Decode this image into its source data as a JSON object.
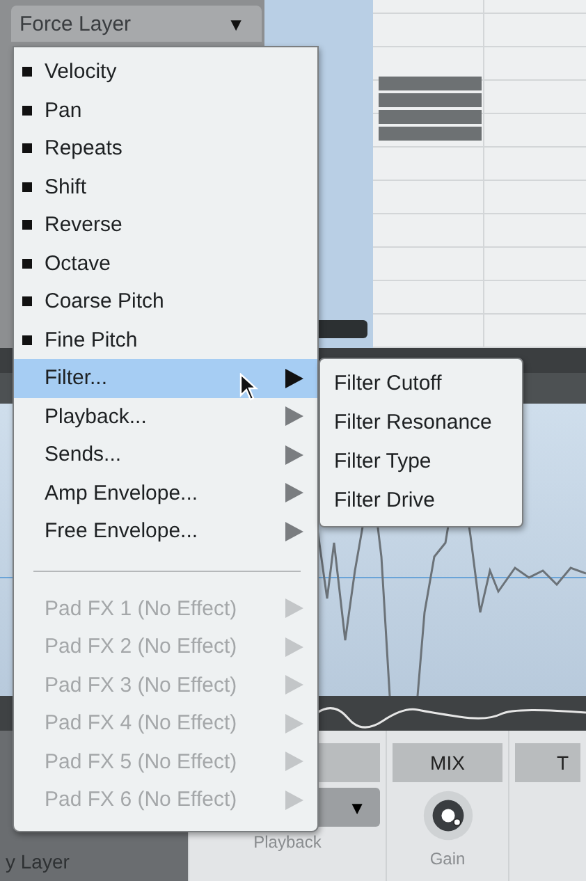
{
  "dropdown": {
    "label": "Force Layer",
    "arrow": "▼"
  },
  "menu": {
    "items": [
      {
        "kind": "bullet",
        "label": "Velocity",
        "selected": false
      },
      {
        "kind": "bullet",
        "label": "Pan",
        "selected": false
      },
      {
        "kind": "bullet",
        "label": "Repeats",
        "selected": false
      },
      {
        "kind": "bullet",
        "label": "Shift",
        "selected": false
      },
      {
        "kind": "bullet",
        "label": "Reverse",
        "selected": false
      },
      {
        "kind": "bullet",
        "label": "Octave",
        "selected": false
      },
      {
        "kind": "bullet",
        "label": "Coarse Pitch",
        "selected": false
      },
      {
        "kind": "bullet",
        "label": "Fine Pitch",
        "selected": false
      },
      {
        "kind": "submenu",
        "label": "Filter...",
        "selected": true,
        "disabled": false
      },
      {
        "kind": "submenu",
        "label": "Playback...",
        "selected": false,
        "disabled": false
      },
      {
        "kind": "submenu",
        "label": "Sends...",
        "selected": false,
        "disabled": false
      },
      {
        "kind": "submenu",
        "label": "Amp Envelope...",
        "selected": false,
        "disabled": false
      },
      {
        "kind": "submenu",
        "label": "Free Envelope...",
        "selected": false,
        "disabled": false
      },
      {
        "kind": "separator"
      },
      {
        "kind": "submenu",
        "label": "Pad FX 1 (No Effect)",
        "selected": false,
        "disabled": true
      },
      {
        "kind": "submenu",
        "label": "Pad FX 2 (No Effect)",
        "selected": false,
        "disabled": true
      },
      {
        "kind": "submenu",
        "label": "Pad FX 3 (No Effect)",
        "selected": false,
        "disabled": true
      },
      {
        "kind": "submenu",
        "label": "Pad FX 4 (No Effect)",
        "selected": false,
        "disabled": true
      },
      {
        "kind": "submenu",
        "label": "Pad FX 5 (No Effect)",
        "selected": false,
        "disabled": true
      },
      {
        "kind": "submenu",
        "label": "Pad FX 6 (No Effect)",
        "selected": false,
        "disabled": true
      }
    ]
  },
  "submenu": {
    "items": [
      {
        "label": "Filter Cutoff"
      },
      {
        "label": "Filter Resonance"
      },
      {
        "label": "Filter Type"
      },
      {
        "label": "Filter Drive"
      }
    ]
  },
  "background": {
    "layer_label": "y Layer",
    "mode_arrow": "▼",
    "mode_caption": "Playback",
    "headers": [
      "MIX",
      "T"
    ],
    "knob_caption": "Gain"
  }
}
